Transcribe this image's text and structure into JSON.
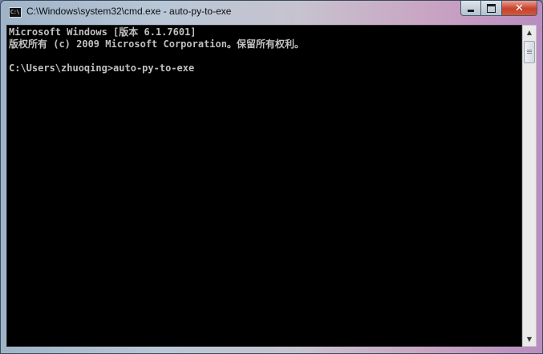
{
  "window": {
    "title": "C:\\Windows\\system32\\cmd.exe - auto-py-to-exe",
    "icon_text": "C:\\",
    "caption_buttons": {
      "minimize": "minimize-icon",
      "maximize": "maximize-icon",
      "close": "✕"
    }
  },
  "console": {
    "lines": [
      "Microsoft Windows [版本 6.1.7601]",
      "版权所有 (c) 2009 Microsoft Corporation。保留所有权利。",
      "",
      "C:\\Users\\zhuoqing>auto-py-to-exe"
    ]
  },
  "scrollbar": {
    "up": "▲",
    "down": "▼"
  },
  "colors": {
    "console_bg": "#000000",
    "console_text": "#c0c0c0"
  }
}
